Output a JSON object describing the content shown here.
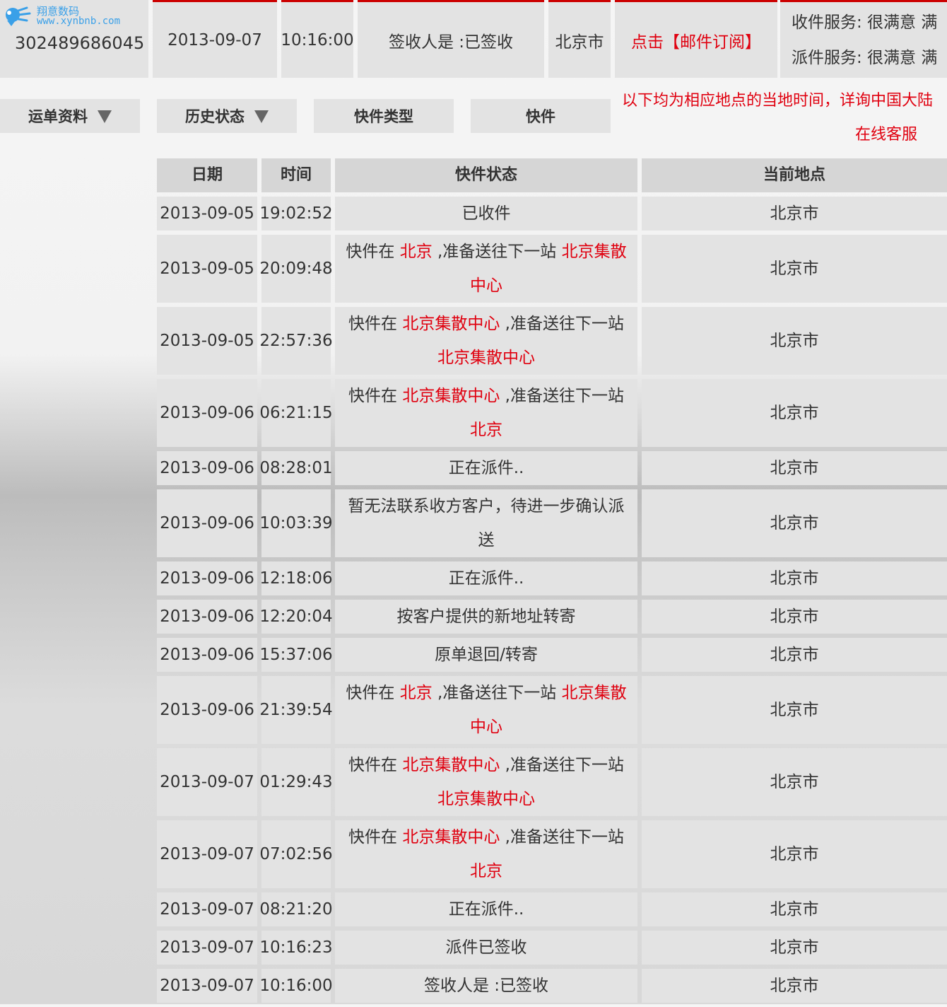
{
  "logo": {
    "name": "翔意数码",
    "url": "www.xynbnb.com"
  },
  "summary": {
    "tracking_number": "302489686045",
    "date": "2013-09-07",
    "time": "10:16:00",
    "status": "签收人是 :已签收",
    "city": "北京市",
    "subscribe_link": "点击【邮件订阅】",
    "pickup_service": "收件服务:  很满意  满",
    "delivery_service": "派件服务:  很满意  满"
  },
  "tabs": [
    {
      "label": "运单资料"
    },
    {
      "label": "历史状态"
    },
    {
      "label": "快件类型"
    },
    {
      "label": "快件"
    }
  ],
  "notice": "以下均为相应地点的当地时间，详询中国大陆",
  "online_service": "在线客服",
  "table": {
    "headers": [
      "日期",
      "时间",
      "快件状态",
      "当前地点"
    ],
    "rows": [
      {
        "date": "2013-09-05",
        "time": "19:02:52",
        "status": [
          {
            "t": "已收件"
          }
        ],
        "location": "北京市"
      },
      {
        "date": "2013-09-05",
        "time": "20:09:48",
        "status": [
          {
            "t": "快件在 "
          },
          {
            "t": "北京",
            "red": true
          },
          {
            "t": " ,准备送往下一站 "
          },
          {
            "t": "北京集散中心",
            "red": true
          }
        ],
        "location": "北京市"
      },
      {
        "date": "2013-09-05",
        "time": "22:57:36",
        "status": [
          {
            "t": "快件在 "
          },
          {
            "t": "北京集散中心",
            "red": true
          },
          {
            "t": " ,准备送往下一站 "
          },
          {
            "t": "北京集散中心",
            "red": true
          }
        ],
        "location": "北京市"
      },
      {
        "date": "2013-09-06",
        "time": "06:21:15",
        "status": [
          {
            "t": "快件在 "
          },
          {
            "t": "北京集散中心",
            "red": true
          },
          {
            "t": " ,准备送往下一站 "
          },
          {
            "t": "北京",
            "red": true
          }
        ],
        "location": "北京市"
      },
      {
        "date": "2013-09-06",
        "time": "08:28:01",
        "status": [
          {
            "t": "正在派件.."
          }
        ],
        "location": "北京市"
      },
      {
        "date": "2013-09-06",
        "time": "10:03:39",
        "status": [
          {
            "t": "暂无法联系收方客户，待进一步确认派送"
          }
        ],
        "location": "北京市"
      },
      {
        "date": "2013-09-06",
        "time": "12:18:06",
        "status": [
          {
            "t": "正在派件.."
          }
        ],
        "location": "北京市"
      },
      {
        "date": "2013-09-06",
        "time": "12:20:04",
        "status": [
          {
            "t": "按客户提供的新地址转寄"
          }
        ],
        "location": "北京市"
      },
      {
        "date": "2013-09-06",
        "time": "15:37:06",
        "status": [
          {
            "t": "原单退回/转寄"
          }
        ],
        "location": "北京市"
      },
      {
        "date": "2013-09-06",
        "time": "21:39:54",
        "status": [
          {
            "t": "快件在 "
          },
          {
            "t": "北京",
            "red": true
          },
          {
            "t": " ,准备送往下一站 "
          },
          {
            "t": "北京集散中心",
            "red": true
          }
        ],
        "location": "北京市"
      },
      {
        "date": "2013-09-07",
        "time": "01:29:43",
        "status": [
          {
            "t": "快件在 "
          },
          {
            "t": "北京集散中心",
            "red": true
          },
          {
            "t": " ,准备送往下一站 "
          },
          {
            "t": "北京集散中心",
            "red": true
          }
        ],
        "location": "北京市"
      },
      {
        "date": "2013-09-07",
        "time": "07:02:56",
        "status": [
          {
            "t": "快件在 "
          },
          {
            "t": "北京集散中心",
            "red": true
          },
          {
            "t": " ,准备送往下一站 "
          },
          {
            "t": "北京",
            "red": true
          }
        ],
        "location": "北京市"
      },
      {
        "date": "2013-09-07",
        "time": "08:21:20",
        "status": [
          {
            "t": "正在派件.."
          }
        ],
        "location": "北京市"
      },
      {
        "date": "2013-09-07",
        "time": "10:16:23",
        "status": [
          {
            "t": "派件已签收"
          }
        ],
        "location": "北京市"
      },
      {
        "date": "2013-09-07",
        "time": "10:16:00",
        "status": [
          {
            "t": "签收人是 :已签收"
          }
        ],
        "location": "北京市"
      }
    ]
  },
  "colors": {
    "accent_red": "#e0000f",
    "cell_bg": "#e3e3e3",
    "logo_blue": "#3aa0e8"
  }
}
